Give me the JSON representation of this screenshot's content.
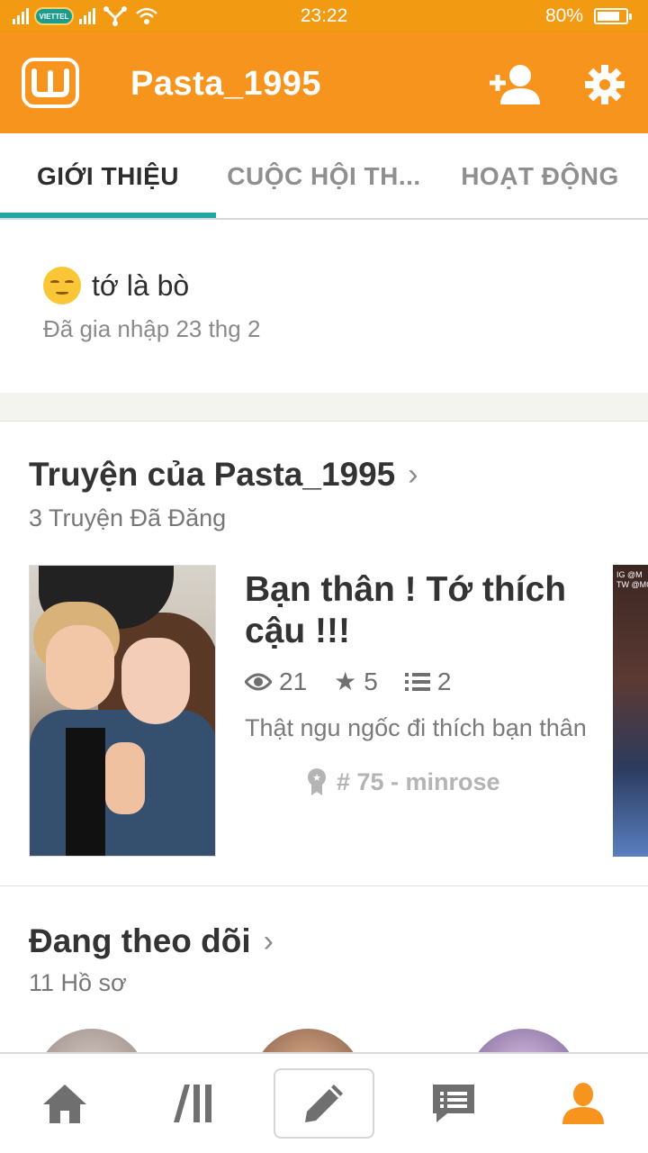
{
  "status_bar": {
    "carrier": "VIETTEL",
    "time": "23:22",
    "battery": "80%",
    "battery_level": 0.8
  },
  "app_bar": {
    "title": "Pasta_1995",
    "logo_icon": "wattpad-logo",
    "add_user_icon": "add-user-icon",
    "settings_icon": "gear-icon",
    "brand_color": "#f7941d"
  },
  "tabs": [
    {
      "label": "GIỚI THIỆU",
      "active": true
    },
    {
      "label": "CUỘC HỘI TH...",
      "active": false
    },
    {
      "label": "HOẠT ĐỘNG",
      "active": false
    }
  ],
  "accent_color": "#1ea7a4",
  "bio": {
    "text": "tớ là bò",
    "joined": "Đã gia nhập 23 thg 2"
  },
  "stories": {
    "title": "Truyện của Pasta_1995",
    "count_label": "3 Truyện Đã Đăng",
    "items": [
      {
        "title": "Bạn thân ! Tớ thích cậu !!!",
        "reads": "21",
        "votes": "5",
        "parts": "2",
        "description": "Thật ngu ngốc đi thích bạn thân",
        "rank": "# 75 - minrose"
      }
    ],
    "next_cover_text": "IG @M\nTW @MO"
  },
  "following": {
    "title": "Đang theo dõi",
    "count_label": "11 Hồ sơ"
  },
  "bottom_nav": [
    {
      "icon": "home-icon"
    },
    {
      "icon": "library-icon"
    },
    {
      "icon": "pencil-icon"
    },
    {
      "icon": "messages-icon"
    },
    {
      "icon": "profile-icon",
      "active": true
    }
  ]
}
